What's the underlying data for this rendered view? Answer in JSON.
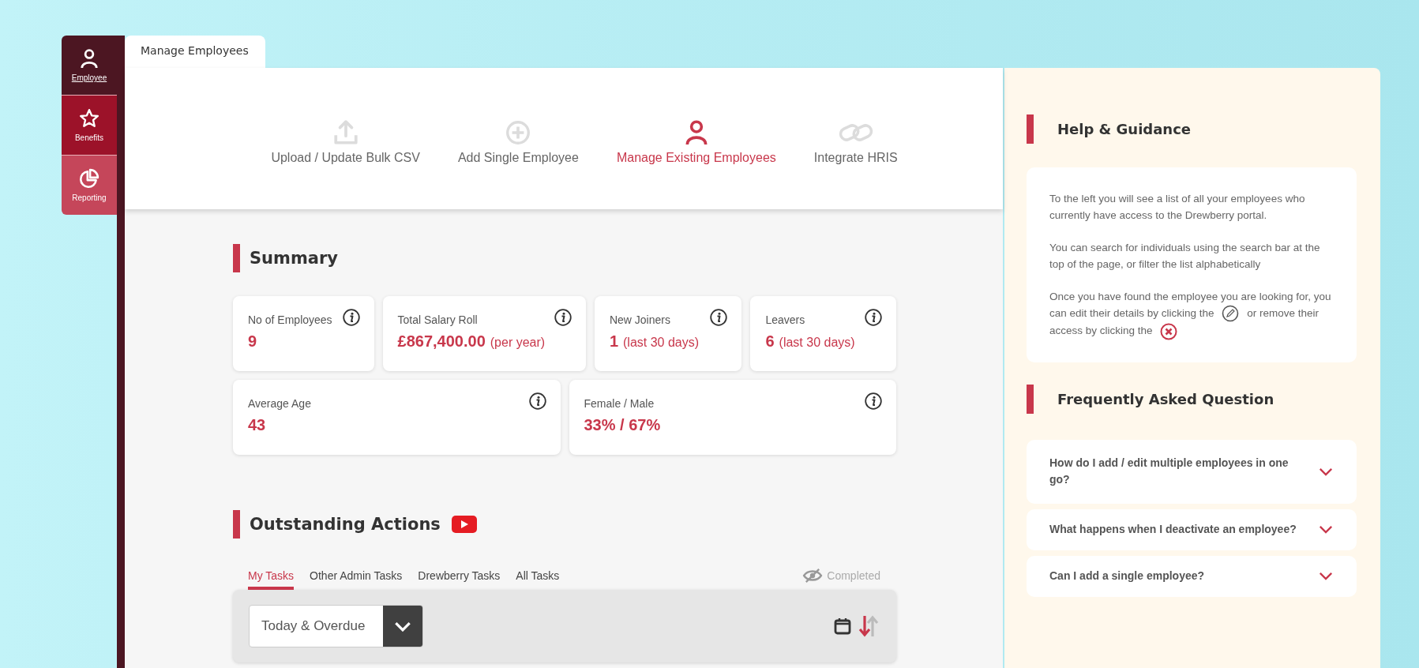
{
  "sidebar": {
    "items": [
      {
        "label": "Employee",
        "selected": true
      },
      {
        "label": "Benefits",
        "selected": false
      },
      {
        "label": "Reporting",
        "selected": false
      }
    ]
  },
  "page_tab": {
    "label": "Manage Employees"
  },
  "nav": [
    {
      "label": "Upload / Update Bulk CSV",
      "selected": false
    },
    {
      "label": "Add Single Employee",
      "selected": false
    },
    {
      "label": "Manage Existing Employees",
      "selected": true
    },
    {
      "label": "Integrate HRIS",
      "selected": false
    }
  ],
  "summary": {
    "title": "Summary",
    "cards": [
      {
        "label": "No of Employees",
        "value": "9"
      },
      {
        "label": "Total Salary Roll",
        "value": "£867,400.00",
        "suffix": "(per year)"
      },
      {
        "label": "New Joiners",
        "value": "1",
        "suffix": "(last 30 days)"
      },
      {
        "label": "Leavers",
        "value": "6",
        "suffix": "(last 30 days)"
      },
      {
        "label": "Average Age",
        "value": "43"
      },
      {
        "label": "Female / Male",
        "value": "33% / 67%"
      }
    ]
  },
  "actions": {
    "title": "Outstanding Actions",
    "tabs": [
      {
        "label": "My Tasks",
        "selected": true
      },
      {
        "label": "Other Admin Tasks",
        "selected": false
      },
      {
        "label": "Drewberry Tasks",
        "selected": false
      },
      {
        "label": "All Tasks",
        "selected": false
      }
    ],
    "completed": "Completed",
    "filter": {
      "value": "Today & Overdue"
    }
  },
  "help": {
    "title": "Help & Guidance",
    "paragraphs": [
      "To the left you will see a list of all your employees who currently have access to the Drewberry portal.",
      "You can search for individuals using the search bar at the top of the page, or filter the list alphabetically"
    ],
    "edit_text": "Once you have found the employee you are looking for, you can edit their details by clicking the",
    "remove_text": "or remove their access by clicking the"
  },
  "faq": {
    "title": "Frequently Asked Question",
    "items": [
      {
        "question": "How do I add / edit multiple employees in one go?",
        "expanded": false
      },
      {
        "question": "What happens when I deactivate an employee?",
        "expanded": false
      },
      {
        "question": "Can I add a single employee?",
        "expanded": false
      }
    ]
  }
}
